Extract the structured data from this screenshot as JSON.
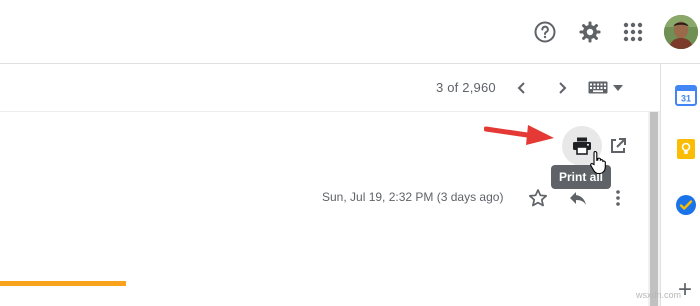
{
  "toolbar": {
    "counter": "3 of 2,960"
  },
  "message": {
    "date": "Sun, Jul 19, 2:32 PM (3 days ago)",
    "tooltip": "Print all"
  },
  "sidepanel": {
    "calendar_day": "31",
    "add_symbol": "+"
  },
  "watermark": "wsxdn.com",
  "colors": {
    "icon_gray": "#5f6368",
    "tooltip_bg": "#5f6368",
    "arrow_red": "#e53935",
    "accent_orange": "#f9a21b",
    "calendar_blue": "#4285f4",
    "keep_yellow": "#fbbc04",
    "tasks_blue": "#1a73e8"
  }
}
